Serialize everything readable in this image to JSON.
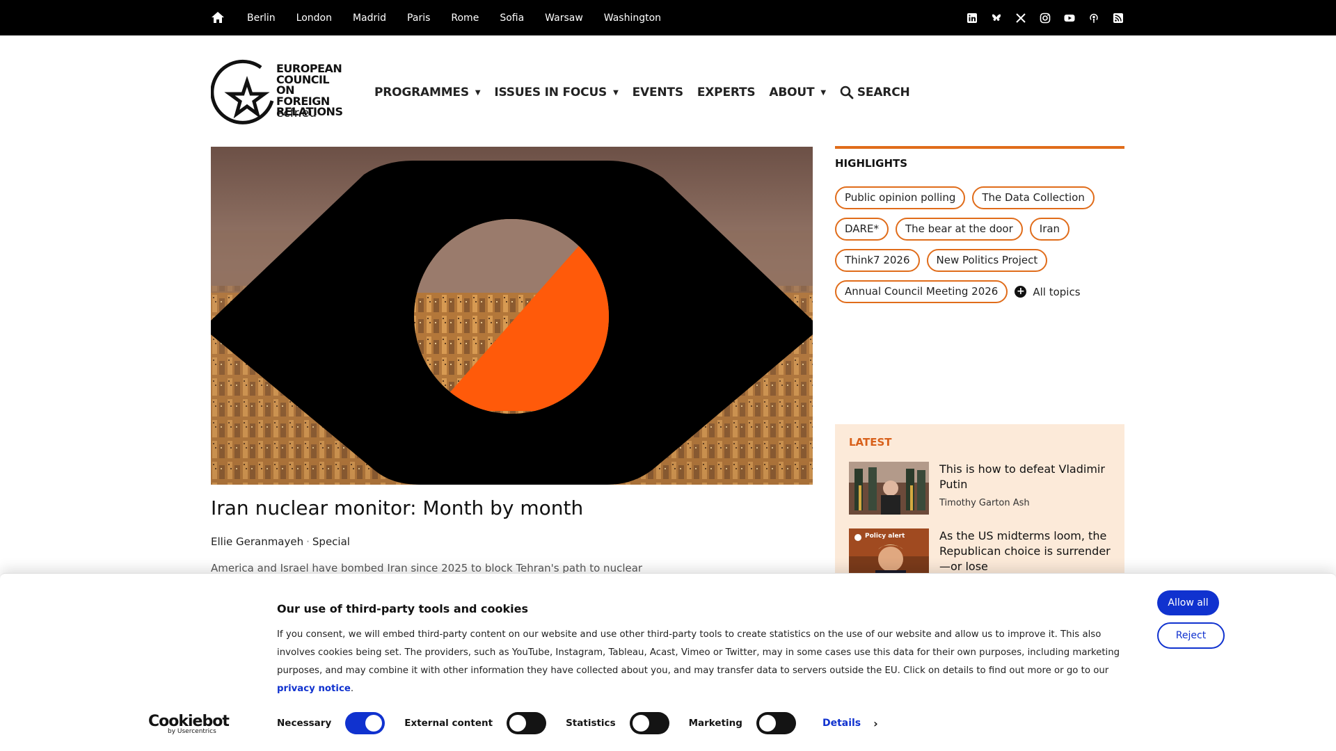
{
  "topbar": {
    "home_icon": "home-icon",
    "cities": [
      "Berlin",
      "London",
      "Madrid",
      "Paris",
      "Rome",
      "Sofia",
      "Warsaw",
      "Washington"
    ],
    "social_icons": [
      "linkedin-icon",
      "bluesky-icon",
      "x-icon",
      "instagram-icon",
      "youtube-icon",
      "podcast-icon",
      "rss-icon"
    ]
  },
  "logo": {
    "line1": "EUROPEAN",
    "line2": "COUNCIL",
    "line3": "ON FOREIGN",
    "line4": "RELATIONS",
    "url": "ecfr.eu"
  },
  "nav": {
    "programmes": "PROGRAMMES",
    "issues": "ISSUES IN FOCUS",
    "events": "EVENTS",
    "experts": "EXPERTS",
    "about": "ABOUT",
    "search": "SEARCH"
  },
  "article": {
    "title": "Iran nuclear monitor: Month by month",
    "author": "Ellie Geranmayeh",
    "type": "Special",
    "excerpt": "America and Israel have bombed Iran since 2025 to block Tehran's path to nuclear"
  },
  "highlights": {
    "title": "HIGHLIGHTS",
    "row1": [
      "Public opinion polling",
      "The Data Collection"
    ],
    "row2": [
      "DARE*",
      "The bear at the door",
      "Iran"
    ],
    "row3": [
      "Think7 2026",
      "New Politics Project"
    ],
    "row4": [
      "Annual Council Meeting 2026"
    ],
    "all_topics": "All topics"
  },
  "latest": {
    "title": "LATEST",
    "items": [
      {
        "headline": "This is how to defeat Vladimir Putin",
        "author": "Timothy Garton Ash"
      },
      {
        "headline": "As the US midterms loom, the Republican choice is surrender—or lose",
        "badge": "Policy alert"
      }
    ]
  },
  "cookie": {
    "title": "Our use of third-party tools and cookies",
    "text": "If you consent, we will embed third-party content on our website and use other third-party tools to create statistics on the use of our website and allow us to improve it. This also involves cookies being set. The providers, such as YouTube, Instagram, Tableau, Acast, Vimeo  or Twitter, may in some cases use this data for their own purposes, including marketing purposes, and may combine it with other information they have collected about you, and may transfer data to servers outside the EU. Click on details to find out more or go to our ",
    "link": "privacy notice",
    "text_end": ".",
    "allow_all": "Allow all",
    "reject": "Reject",
    "brand": "Cookiebot",
    "brand_by": "by Usercentrics",
    "toggles": [
      {
        "label": "Necessary",
        "on": true
      },
      {
        "label": "External content",
        "on": false
      },
      {
        "label": "Statistics",
        "on": false
      },
      {
        "label": "Marketing",
        "on": false
      }
    ],
    "details": "Details",
    "accent": "#1032cf"
  },
  "colors": {
    "accent_orange": "#e06c1a",
    "latest_bg": "#fcead9",
    "topbar_bg": "#000000"
  }
}
